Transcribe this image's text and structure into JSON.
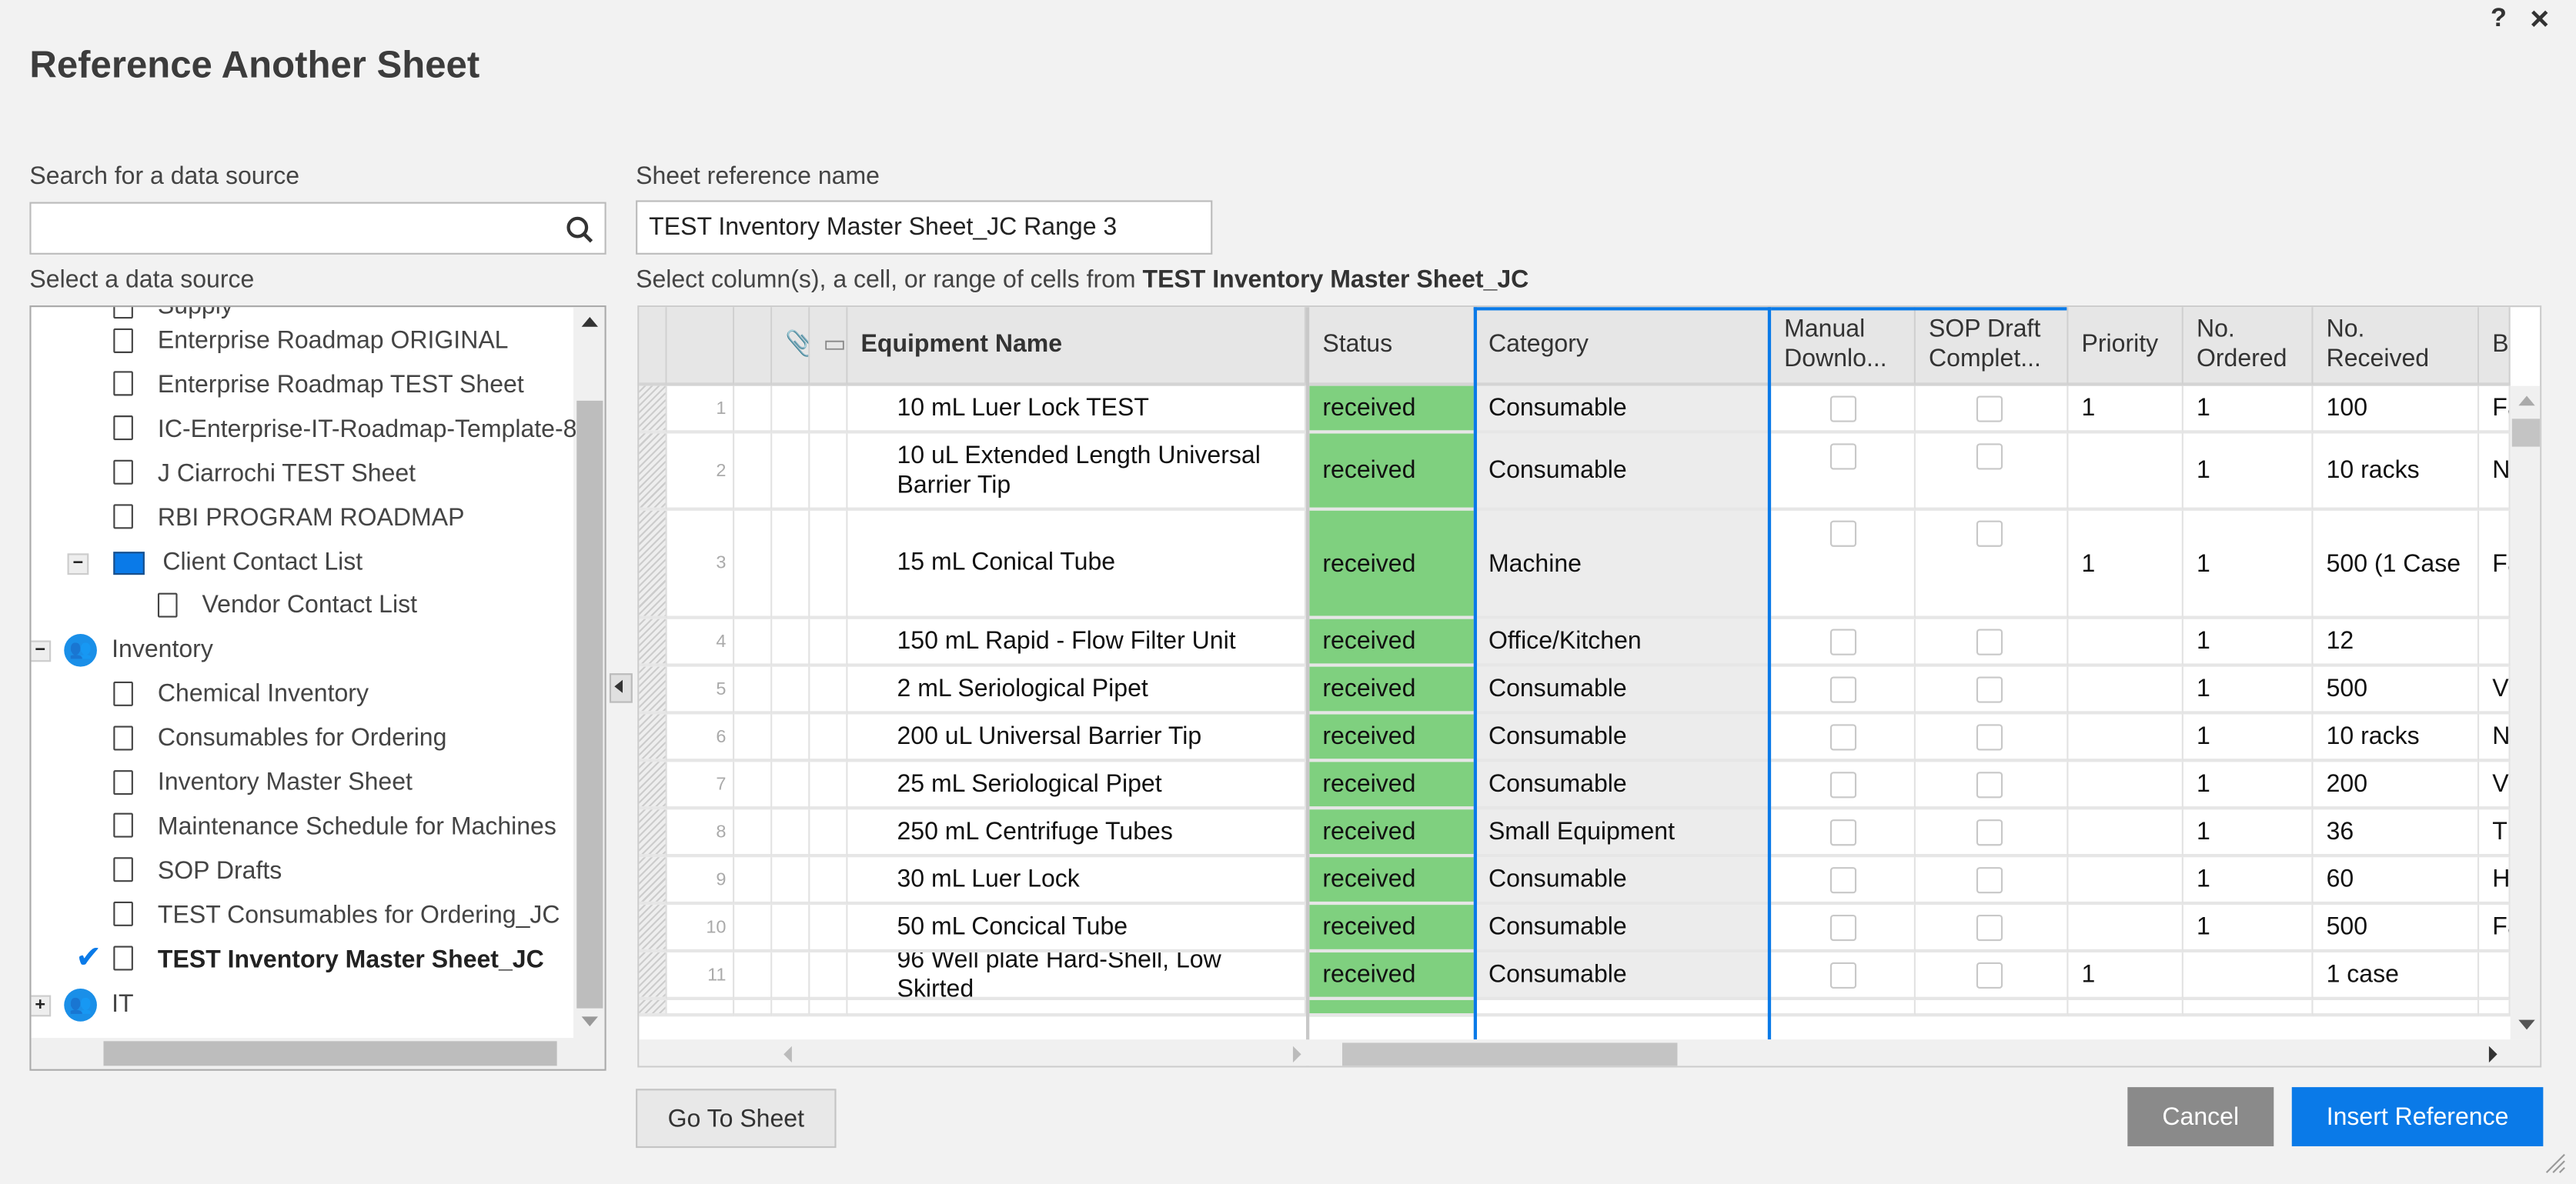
{
  "dialog": {
    "title": "Reference Another Sheet",
    "help_icon": "?",
    "close_icon": "×"
  },
  "search": {
    "label": "Search for a data source",
    "value": "",
    "placeholder": ""
  },
  "select_label": "Select a data source",
  "tree": [
    {
      "label": "Supply",
      "type": "sheet",
      "level": 2,
      "partial": true
    },
    {
      "label": "Enterprise Roadmap ORIGINAL",
      "type": "sheet",
      "level": 2
    },
    {
      "label": "Enterprise Roadmap TEST Sheet",
      "type": "sheet",
      "level": 2
    },
    {
      "label": "IC-Enterprise-IT-Roadmap-Template-8",
      "type": "sheet",
      "level": 2
    },
    {
      "label": "J Ciarrochi TEST Sheet",
      "type": "sheet",
      "level": 2
    },
    {
      "label": "RBI PROGRAM ROADMAP",
      "type": "sheet",
      "level": 2
    },
    {
      "label": "Client Contact List",
      "type": "folder",
      "level": 1,
      "toggle": "−"
    },
    {
      "label": "Vendor Contact List",
      "type": "sheet",
      "level": 3
    },
    {
      "label": "Inventory",
      "type": "workspace",
      "level": 0,
      "toggle": "−"
    },
    {
      "label": "Chemical Inventory",
      "type": "sheet",
      "level": 2
    },
    {
      "label": "Consumables for Ordering",
      "type": "sheet",
      "level": 2
    },
    {
      "label": "Inventory Master Sheet",
      "type": "sheet",
      "level": 2
    },
    {
      "label": "Maintenance Schedule for Machines",
      "type": "sheet",
      "level": 2
    },
    {
      "label": "SOP Drafts",
      "type": "sheet",
      "level": 2
    },
    {
      "label": "TEST Consumables for Ordering_JC",
      "type": "sheet",
      "level": 2
    },
    {
      "label": "TEST Inventory Master Sheet_JC",
      "type": "sheet",
      "level": 2,
      "selected": true
    },
    {
      "label": "IT",
      "type": "workspace",
      "level": 0,
      "toggle": "+"
    }
  ],
  "ref_name": {
    "label": "Sheet reference name",
    "value": "TEST Inventory Master Sheet_JC Range 3"
  },
  "select_prompt": {
    "text": "Select column(s), a cell, or range of cells from ",
    "sheet": "TEST Inventory Master Sheet_JC"
  },
  "columns": [
    "Equipment Name",
    "Status",
    "Category",
    "Manual Downlo...",
    "SOP Draft Complet...",
    "Priority",
    "No. Ordered",
    "No. Received",
    "Bran"
  ],
  "rows": [
    {
      "n": "1",
      "name": "10 mL Luer Lock TEST",
      "status": "received",
      "category": "Consumable",
      "priority": "1",
      "ordered": "1",
      "received": "100",
      "brand": "Fa"
    },
    {
      "n": "2",
      "name": "10 uL Extended Length Universal Barrier Tip",
      "status": "received",
      "category": "Consumable",
      "priority": "",
      "ordered": "1",
      "received": "10 racks",
      "brand": "N"
    },
    {
      "n": "3",
      "name": "15 mL Conical Tube",
      "status": "received",
      "category": "Machine",
      "priority": "1",
      "ordered": "1",
      "received": "500 (1 Case",
      "brand": "Fa"
    },
    {
      "n": "4",
      "name": "150 mL Rapid - Flow Filter Unit",
      "status": "received",
      "category": "Office/Kitchen",
      "priority": "",
      "ordered": "1",
      "received": "12",
      "brand": ""
    },
    {
      "n": "5",
      "name": "2 mL Seriological Pipet",
      "status": "received",
      "category": "Consumable",
      "priority": "",
      "ordered": "1",
      "received": "500",
      "brand": "V"
    },
    {
      "n": "6",
      "name": "200 uL Universal Barrier Tip",
      "status": "received",
      "category": "Consumable",
      "priority": "",
      "ordered": "1",
      "received": "10 racks",
      "brand": "N"
    },
    {
      "n": "7",
      "name": "25 mL Seriological Pipet",
      "status": "received",
      "category": "Consumable",
      "priority": "",
      "ordered": "1",
      "received": "200",
      "brand": "V"
    },
    {
      "n": "8",
      "name": "250 mL Centrifuge Tubes",
      "status": "received",
      "category": "Small Equipment",
      "priority": "",
      "ordered": "1",
      "received": "36",
      "brand": "Tl"
    },
    {
      "n": "9",
      "name": "30 mL Luer Lock",
      "status": "received",
      "category": "Consumable",
      "priority": "",
      "ordered": "1",
      "received": "60",
      "brand": "H"
    },
    {
      "n": "10",
      "name": "50 mL Concical Tube",
      "status": "received",
      "category": "Consumable",
      "priority": "",
      "ordered": "1",
      "received": "500",
      "brand": "Fa"
    },
    {
      "n": "11",
      "name": "96 Well plate Hard-Shell, Low Skirted",
      "status": "received",
      "category": "Consumable",
      "priority": "1",
      "ordered": "",
      "received": "1 case",
      "brand": ""
    }
  ],
  "colors": {
    "status_received": "#7fd07f",
    "accent": "#0a7ae8",
    "cancel": "#8a8a8a"
  },
  "buttons": {
    "go_to_sheet": "Go To Sheet",
    "cancel": "Cancel",
    "insert": "Insert Reference"
  }
}
